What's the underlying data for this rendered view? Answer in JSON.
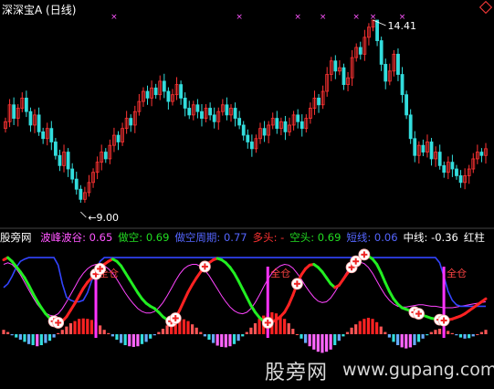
{
  "header": {
    "title": "深深宝A (日线)"
  },
  "price_panel": {
    "high_label": "14.41",
    "low_label": "9.00"
  },
  "indicator_bar": {
    "name": "股旁网",
    "items": [
      {
        "label": "波峰波谷:",
        "value": "0.65",
        "label_color": "#ff55ff",
        "value_color": "#ff55ff"
      },
      {
        "label": "做空:",
        "value": "0.69",
        "label_color": "#22dd22",
        "value_color": "#22dd22"
      },
      {
        "label": "做空周期:",
        "value": "0.77",
        "label_color": "#5566ff",
        "value_color": "#5566ff"
      },
      {
        "label": "多头:",
        "value": "-",
        "label_color": "#ff3333",
        "value_color": "#ff3333"
      },
      {
        "label": "空头:",
        "value": "0.69",
        "label_color": "#22dd22",
        "value_color": "#22dd22"
      },
      {
        "label": "短线:",
        "value": "0.06",
        "label_color": "#5566ff",
        "value_color": "#5566ff"
      },
      {
        "label": "中线:",
        "value": "-0.36",
        "label_color": "#ffffff",
        "value_color": "#ffffff"
      },
      {
        "label": "红柱",
        "value": "",
        "label_color": "#ffffff",
        "value_color": "#ffffff"
      }
    ]
  },
  "signals": {
    "full_position_label": "全仓"
  },
  "watermark": {
    "text": "股旁网",
    "url": "www.gupang.com"
  },
  "colors": {
    "up_candle": "#ff3333",
    "down_candle": "#33dddd",
    "background": "#000000",
    "marker": "#ff55ff",
    "strong_line": "#ff2222",
    "weak_line": "#22ee22",
    "cycle_line": "#3344ff",
    "thin_line": "#ff44ff",
    "signal_bar": "#ff33ff"
  },
  "chart_data": [
    {
      "type": "candlestick",
      "title": "深深宝A (日线)",
      "annotations": [
        {
          "text": "14.41",
          "kind": "high"
        },
        {
          "text": "9.00",
          "kind": "low"
        }
      ],
      "ylim": [
        9.0,
        14.41
      ],
      "close": [
        11.4,
        11.9,
        11.5,
        11.8,
        12.1,
        11.7,
        11.3,
        11.6,
        11.1,
        10.9,
        11.2,
        10.8,
        10.4,
        10.1,
        10.5,
        10.0,
        9.7,
        9.4,
        9.1,
        9.3,
        9.6,
        9.9,
        10.2,
        10.5,
        10.3,
        10.7,
        11.0,
        10.8,
        11.2,
        11.5,
        11.3,
        11.7,
        12.0,
        12.3,
        12.1,
        12.4,
        12.2,
        12.6,
        12.3,
        12.0,
        12.2,
        12.5,
        12.1,
        11.8,
        11.6,
        11.9,
        11.7,
        11.5,
        11.8,
        11.6,
        11.4,
        11.7,
        11.9,
        11.6,
        11.8,
        11.5,
        11.3,
        11.0,
        10.8,
        10.6,
        10.9,
        11.2,
        11.0,
        11.3,
        11.5,
        11.2,
        11.4,
        11.1,
        11.3,
        11.6,
        11.4,
        11.2,
        11.5,
        11.8,
        12.1,
        11.9,
        12.3,
        12.8,
        13.2,
        12.9,
        13.0,
        12.5,
        12.7,
        13.3,
        13.6,
        13.4,
        13.9,
        14.2,
        14.41,
        13.8,
        13.1,
        12.6,
        12.9,
        13.4,
        12.8,
        12.2,
        11.6,
        10.9,
        10.4,
        10.7,
        10.5,
        10.8,
        10.3,
        10.5,
        10.1,
        9.9,
        10.2,
        10.0,
        9.8,
        9.6,
        9.8,
        10.0,
        10.3,
        10.5,
        10.4,
        10.6
      ],
      "up_markers_index": [
        22,
        36,
        52,
        60,
        76,
        80
      ]
    },
    {
      "type": "line",
      "series": [
        {
          "name": "多头",
          "color": "#ff2222"
        },
        {
          "name": "空头",
          "color": "#22ee22"
        },
        {
          "name": "做空周期",
          "color": "#3344ff"
        },
        {
          "name": "波峰波谷",
          "color": "#ff44ff"
        }
      ],
      "ylim": [
        0,
        1
      ],
      "strength": [
        0.92,
        0.95,
        0.9,
        0.83,
        0.76,
        0.68,
        0.58,
        0.47,
        0.37,
        0.28,
        0.2,
        0.14,
        0.1,
        0.08,
        0.1,
        0.16,
        0.25,
        0.34,
        0.44,
        0.54,
        0.62,
        0.68,
        0.73,
        0.8,
        0.86,
        0.9,
        0.93,
        0.9,
        0.84,
        0.75,
        0.66,
        0.57,
        0.48,
        0.4,
        0.34,
        0.3,
        0.27,
        0.22,
        0.16,
        0.12,
        0.1,
        0.14,
        0.25,
        0.37,
        0.49,
        0.59,
        0.68,
        0.76,
        0.83,
        0.88,
        0.92,
        0.94,
        0.92,
        0.88,
        0.82,
        0.74,
        0.64,
        0.53,
        0.42,
        0.31,
        0.22,
        0.15,
        0.1,
        0.08,
        0.09,
        0.12,
        0.16,
        0.22,
        0.32,
        0.45,
        0.6,
        0.72,
        0.8,
        0.85,
        0.86,
        0.82,
        0.76,
        0.68,
        0.6,
        0.55,
        0.58,
        0.66,
        0.74,
        0.82,
        0.9,
        0.96,
        0.99,
        0.97,
        0.93,
        0.86,
        0.75,
        0.62,
        0.5,
        0.4,
        0.33,
        0.28,
        0.26,
        0.24,
        0.22,
        0.2,
        0.18,
        0.16,
        0.14,
        0.13,
        0.12,
        0.11,
        0.12,
        0.13,
        0.15,
        0.17,
        0.2,
        0.24,
        0.28,
        0.32,
        0.36,
        0.4
      ],
      "cycle": [
        0.55,
        0.6,
        0.7,
        0.82,
        0.9,
        0.93,
        0.95,
        0.95,
        0.95,
        0.95,
        0.95,
        0.95,
        0.95,
        0.85,
        0.6,
        0.42,
        0.38,
        0.36,
        0.36,
        0.38,
        0.48,
        0.64,
        0.78,
        0.9,
        0.95,
        0.95,
        0.95,
        0.95,
        0.95,
        0.95,
        0.95,
        0.95,
        0.95,
        0.95,
        0.95,
        0.95,
        0.95,
        0.95,
        0.95,
        0.95,
        0.95,
        0.95,
        0.95,
        0.95,
        0.95,
        0.95,
        0.95,
        0.95,
        0.95,
        0.95,
        0.95,
        0.95,
        0.95,
        0.95,
        0.95,
        0.95,
        0.95,
        0.95,
        0.95,
        0.95,
        0.95,
        0.95,
        0.95,
        0.95,
        0.95,
        0.95,
        0.95,
        0.95,
        0.95,
        0.95,
        0.95,
        0.95,
        0.95,
        0.95,
        0.95,
        0.95,
        0.95,
        0.95,
        0.95,
        0.95,
        0.95,
        0.95,
        0.95,
        0.95,
        0.95,
        0.95,
        0.95,
        0.95,
        0.95,
        0.95,
        0.95,
        0.95,
        0.95,
        0.95,
        0.95,
        0.95,
        0.95,
        0.95,
        0.95,
        0.95,
        0.95,
        0.95,
        0.95,
        0.95,
        0.88,
        0.7,
        0.5,
        0.38,
        0.32,
        0.3,
        0.3,
        0.3,
        0.3,
        0.3,
        0.3,
        0.3
      ],
      "oscillator": [
        0.86,
        0.88,
        0.86,
        0.8,
        0.72,
        0.62,
        0.52,
        0.42,
        0.33,
        0.26,
        0.21,
        0.18,
        0.17,
        0.2,
        0.27,
        0.36,
        0.46,
        0.56,
        0.66,
        0.74,
        0.8,
        0.84,
        0.86,
        0.86,
        0.84,
        0.8,
        0.74,
        0.66,
        0.57,
        0.48,
        0.4,
        0.33,
        0.27,
        0.23,
        0.21,
        0.21,
        0.23,
        0.28,
        0.35,
        0.44,
        0.54,
        0.64,
        0.73,
        0.8,
        0.84,
        0.86,
        0.86,
        0.83,
        0.78,
        0.71,
        0.62,
        0.53,
        0.44,
        0.36,
        0.29,
        0.24,
        0.21,
        0.2,
        0.22,
        0.27,
        0.35,
        0.45,
        0.56,
        0.66,
        0.74,
        0.8,
        0.84,
        0.86,
        0.85,
        0.81,
        0.74,
        0.66,
        0.57,
        0.49,
        0.42,
        0.37,
        0.35,
        0.36,
        0.41,
        0.49,
        0.58,
        0.68,
        0.77,
        0.84,
        0.88,
        0.89,
        0.87,
        0.82,
        0.74,
        0.64,
        0.54,
        0.45,
        0.38,
        0.33,
        0.3,
        0.29,
        0.29,
        0.3,
        0.31,
        0.32,
        0.32,
        0.31,
        0.3,
        0.3,
        0.29,
        0.28,
        0.28,
        0.28,
        0.29,
        0.3,
        0.31,
        0.32,
        0.33,
        0.34,
        0.35,
        0.36
      ],
      "histogram": [
        0.2,
        0.1,
        -0.05,
        -0.15,
        -0.25,
        -0.35,
        -0.45,
        -0.5,
        -0.55,
        -0.5,
        -0.4,
        -0.3,
        -0.15,
        0.05,
        0.2,
        0.35,
        0.5,
        0.6,
        0.7,
        0.72,
        0.7,
        0.65,
        0.55,
        0.4,
        0.2,
        0.05,
        -0.1,
        -0.25,
        -0.4,
        -0.5,
        -0.55,
        -0.58,
        -0.55,
        -0.45,
        -0.35,
        -0.2,
        -0.05,
        0.1,
        0.25,
        0.4,
        0.55,
        0.65,
        0.7,
        0.68,
        0.6,
        0.45,
        0.3,
        0.1,
        -0.1,
        -0.25,
        -0.4,
        -0.52,
        -0.58,
        -0.6,
        -0.55,
        -0.45,
        -0.3,
        -0.1,
        0.1,
        0.3,
        0.5,
        0.7,
        0.85,
        0.95,
        1.0,
        0.95,
        0.85,
        0.7,
        0.5,
        0.25,
        0.0,
        -0.2,
        -0.4,
        -0.55,
        -0.7,
        -0.8,
        -0.85,
        -0.8,
        -0.7,
        -0.5,
        -0.3,
        -0.1,
        0.1,
        0.3,
        0.45,
        0.6,
        0.7,
        0.75,
        0.7,
        0.55,
        0.35,
        0.1,
        -0.15,
        -0.35,
        -0.5,
        -0.6,
        -0.65,
        -0.6,
        -0.5,
        -0.35,
        -0.2,
        -0.05,
        0.1,
        0.2,
        0.25,
        0.22,
        0.15,
        0.05,
        -0.05,
        -0.15,
        -0.2,
        -0.18,
        -0.1,
        0.0,
        0.1,
        0.2
      ],
      "buy_signals_index": [
        12,
        33,
        54,
        80,
        103
      ],
      "full_position_index": [
        22,
        63,
        105
      ]
    }
  ]
}
